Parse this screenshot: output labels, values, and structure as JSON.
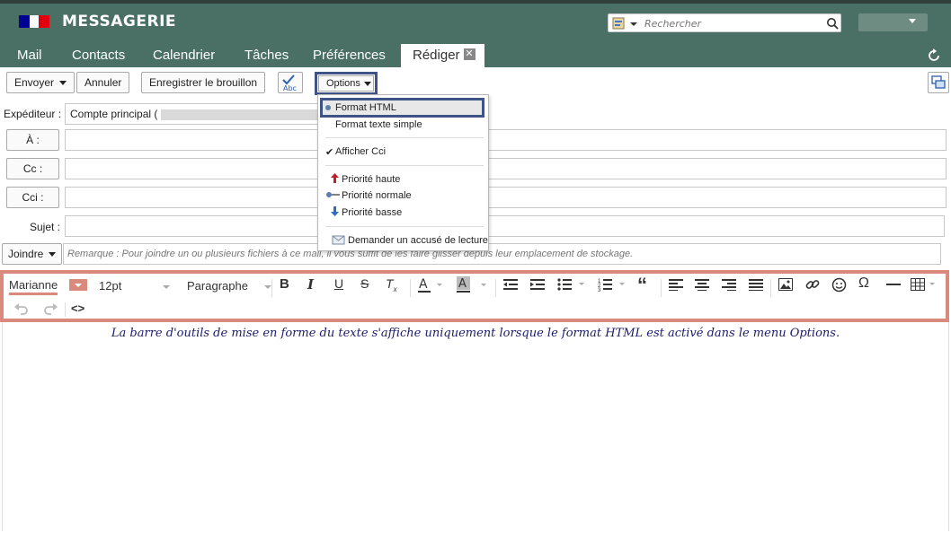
{
  "header": {
    "app_title": "MESSAGERIE",
    "search_placeholder": "Rechercher",
    "flag_colors": [
      "#000091",
      "#ffffff",
      "#e1000f"
    ]
  },
  "tabs": [
    {
      "label": "Mail"
    },
    {
      "label": "Contacts"
    },
    {
      "label": "Calendrier"
    },
    {
      "label": "Tâches"
    },
    {
      "label": "Préférences"
    },
    {
      "label": "Rédiger",
      "active": true
    }
  ],
  "toolbar": {
    "send": "Envoyer",
    "cancel": "Annuler",
    "save_draft": "Enregistrer le brouillon",
    "spellcheck_label": "Abc",
    "options": "Options"
  },
  "options_menu": {
    "format_html": "Format HTML",
    "format_text": "Format texte simple",
    "show_bcc": "Afficher Cci",
    "priority_high": "Priorité haute",
    "priority_normal": "Priorité normale",
    "priority_low": "Priorité basse",
    "read_receipt": "Demander un accusé de lecture"
  },
  "form": {
    "sender_label": "Expéditeur :",
    "sender_value": "Compte principal (",
    "to_button": "À :",
    "cc_button": "Cc :",
    "bcc_button": "Cci :",
    "subject_label": "Sujet :",
    "attach_button": "Joindre",
    "attach_note": "Remarque : Pour joindre un ou plusieurs fichiers à ce mail, il vous suffit de les faire glisser depuis leur emplacement de stockage."
  },
  "editor": {
    "font_family": "Marianne",
    "font_size": "12pt",
    "block_format": "Paragraphe",
    "italic_glyph": "I",
    "code_glyph": "<>",
    "body_text": "La barre d'outils de mise en forme du texte s'affiche uniquement lorsque le format HTML est activé dans le menu Options.",
    "highlight_color": "#d98a7c",
    "options_highlight_color": "#3e5487"
  }
}
